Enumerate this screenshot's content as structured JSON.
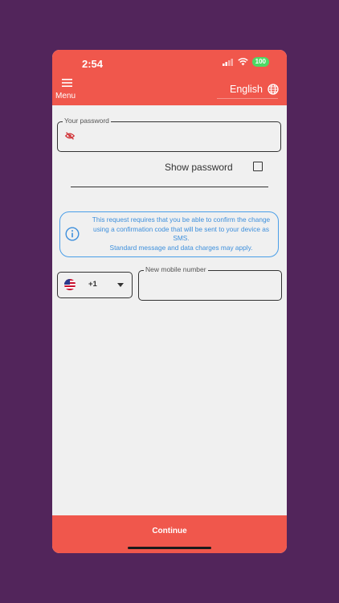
{
  "status_bar": {
    "time": "2:54",
    "battery": "100"
  },
  "header": {
    "menu_label": "Menu",
    "language": "English"
  },
  "password": {
    "label": "Your password",
    "value": "",
    "show_label": "Show password"
  },
  "info": {
    "message": "This request requires that you be able to confirm the change using a confirmation code that will be sent to your device as SMS.",
    "note": "Standard message and data charges may apply."
  },
  "phone": {
    "country_code": "+1",
    "label": "New mobile number",
    "value": ""
  },
  "footer": {
    "continue_label": "Continue"
  },
  "colors": {
    "accent": "#f0574c",
    "info": "#3d8fdc",
    "background": "#52255b"
  }
}
